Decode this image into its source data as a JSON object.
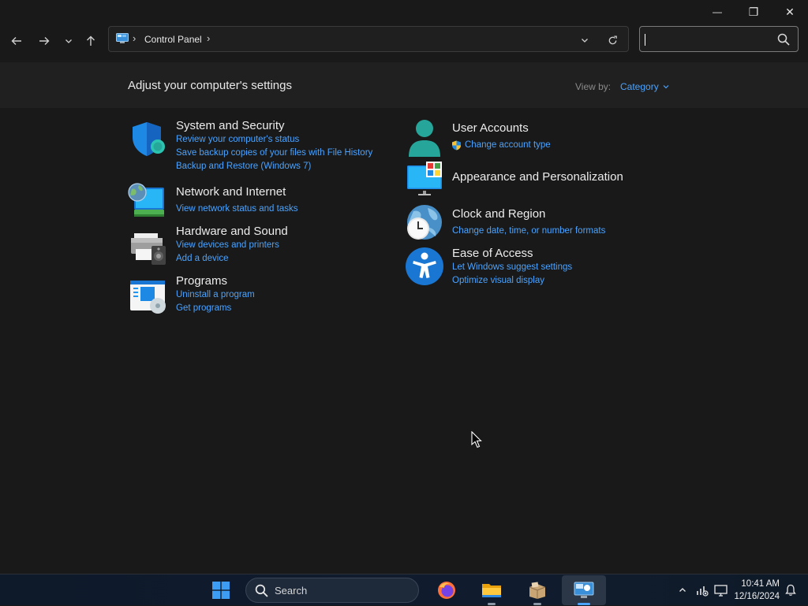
{
  "window": {
    "minimize_glyph": "—",
    "restore_glyph": "❐",
    "close_glyph": "✕"
  },
  "nav": {
    "address": {
      "location": "Control Panel",
      "separator": "›"
    },
    "search": {
      "placeholder": "",
      "value": ""
    }
  },
  "header": {
    "title": "Adjust your computer's settings",
    "view_by_label": "View by:",
    "view_by_value": "Category"
  },
  "categories": {
    "system_security": {
      "title": "System and Security",
      "links": [
        "Review your computer's status",
        "Save backup copies of your files with File History",
        "Backup and Restore (Windows 7)"
      ]
    },
    "network": {
      "title": "Network and Internet",
      "links": [
        "View network status and tasks"
      ]
    },
    "hardware": {
      "title": "Hardware and Sound",
      "links": [
        "View devices and printers",
        "Add a device"
      ]
    },
    "programs": {
      "title": "Programs",
      "links": [
        "Uninstall a program",
        "Get programs"
      ]
    },
    "user_accounts": {
      "title": "User Accounts",
      "links": [
        "Change account type"
      ]
    },
    "appearance": {
      "title": "Appearance and Personalization",
      "links": []
    },
    "clock_region": {
      "title": "Clock and Region",
      "links": [
        "Change date, time, or number formats"
      ]
    },
    "ease_access": {
      "title": "Ease of Access",
      "links": [
        "Let Windows suggest settings",
        "Optimize visual display"
      ]
    }
  },
  "taskbar": {
    "search_label": "Search",
    "time": "10:41 AM",
    "date": "12/16/2024"
  },
  "colors": {
    "link": "#4aa3ff",
    "background": "#191919",
    "header_band": "#202020",
    "accent": "#4aa3ff"
  },
  "icons": [
    "back-arrow-icon",
    "forward-arrow-icon",
    "recent-locations-icon",
    "up-arrow-icon",
    "control-panel-icon",
    "dropdown-chevron-icon",
    "refresh-icon",
    "search-icon",
    "shield-icon",
    "globe-monitor-icon",
    "printer-speaker-icon",
    "programs-icon",
    "user-icon",
    "uac-shield-icon",
    "monitor-tiles-icon",
    "clock-globe-icon",
    "accessibility-icon",
    "windows-start-icon",
    "firefox-icon",
    "file-explorer-icon",
    "package-icon",
    "control-panel-app-icon",
    "chevron-up-icon",
    "network-icon",
    "display-icon",
    "notification-bell-icon"
  ]
}
